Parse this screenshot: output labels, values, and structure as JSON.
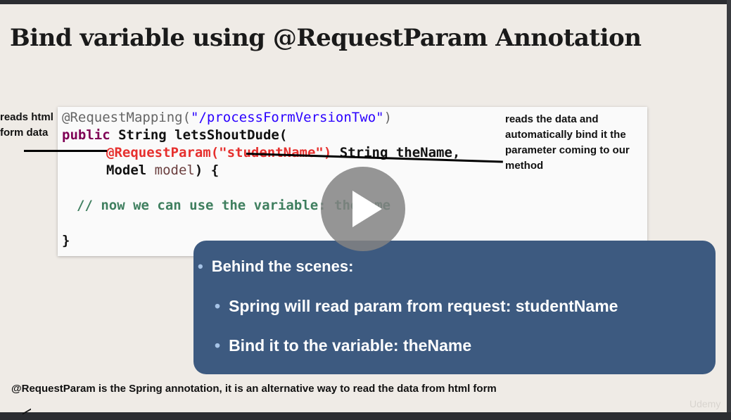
{
  "slide": {
    "title": "Bind variable using @RequestParam Annotation"
  },
  "code": {
    "line1_annotation": "@RequestMapping(",
    "line1_path": "\"/processFormVersionTwo\"",
    "line1_close": ")",
    "line2_kw": "public",
    "line2_rest": " String letsShoutDude(",
    "line3_ann": "@RequestParam(",
    "line3_str": "\"studentName\"",
    "line3_close": ")",
    "line3_rest": " String theName,",
    "line4_type": "Model ",
    "line4_var": "model",
    "line4_rest": ") {",
    "line5_comment": "// now we can use the variable: theName",
    "line6": "}"
  },
  "notes": {
    "left_line1": "reads html",
    "left_line2": "form data",
    "right_line1": "reads the data and",
    "right_line2": "automatically bind it the",
    "right_line3": "parameter coming to our",
    "right_line4": "method"
  },
  "behind": {
    "heading": "Behind the scenes:",
    "items": [
      "Spring will read param from request: studentName",
      "Bind it to the variable: theName"
    ]
  },
  "bottom_note": "@RequestParam is the Spring annotation, it is an alternative way to read the data from html form",
  "watermark": "Udemy",
  "player": {
    "play_icon": "play-icon"
  }
}
